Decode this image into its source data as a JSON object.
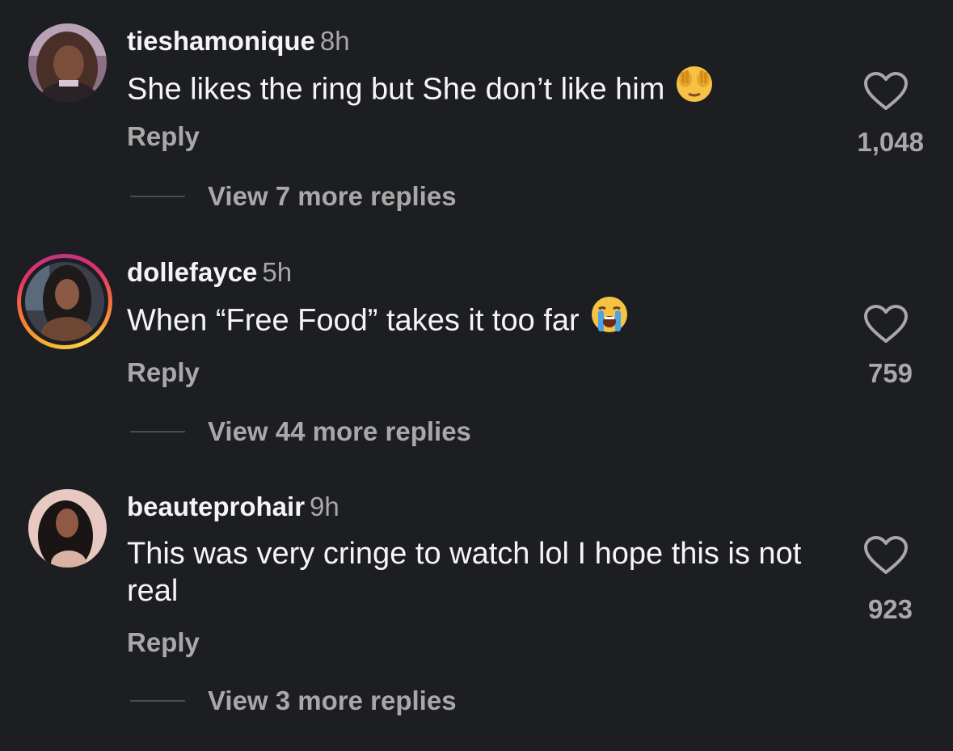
{
  "comments": [
    {
      "username": "tieshamonique",
      "time": "8h",
      "text": "She likes the ring but She don’t like him",
      "emoji": "see-no-evil-monkey",
      "reply_label": "Reply",
      "likes": "1,048",
      "view_replies": "View 7 more replies"
    },
    {
      "username": "dollefayce",
      "time": "5h",
      "text": "When “Free Food” takes it too far",
      "emoji": "loudly-crying-face",
      "reply_label": "Reply",
      "likes": "759",
      "view_replies": "View 44 more replies"
    },
    {
      "username": "beauteprohair",
      "time": "9h",
      "text": "This was very cringe to watch lol I hope this is not real",
      "emoji": "",
      "reply_label": "Reply",
      "likes": "923",
      "view_replies": "View 3 more replies"
    }
  ],
  "colors": {
    "background": "#1c1e21",
    "primary_text": "#f5f5f5",
    "secondary_text": "#a8a8a8",
    "story_ring_start": "#f9b233",
    "story_ring_end": "#e1306c"
  },
  "icons": {
    "like": "heart-outline-icon"
  }
}
